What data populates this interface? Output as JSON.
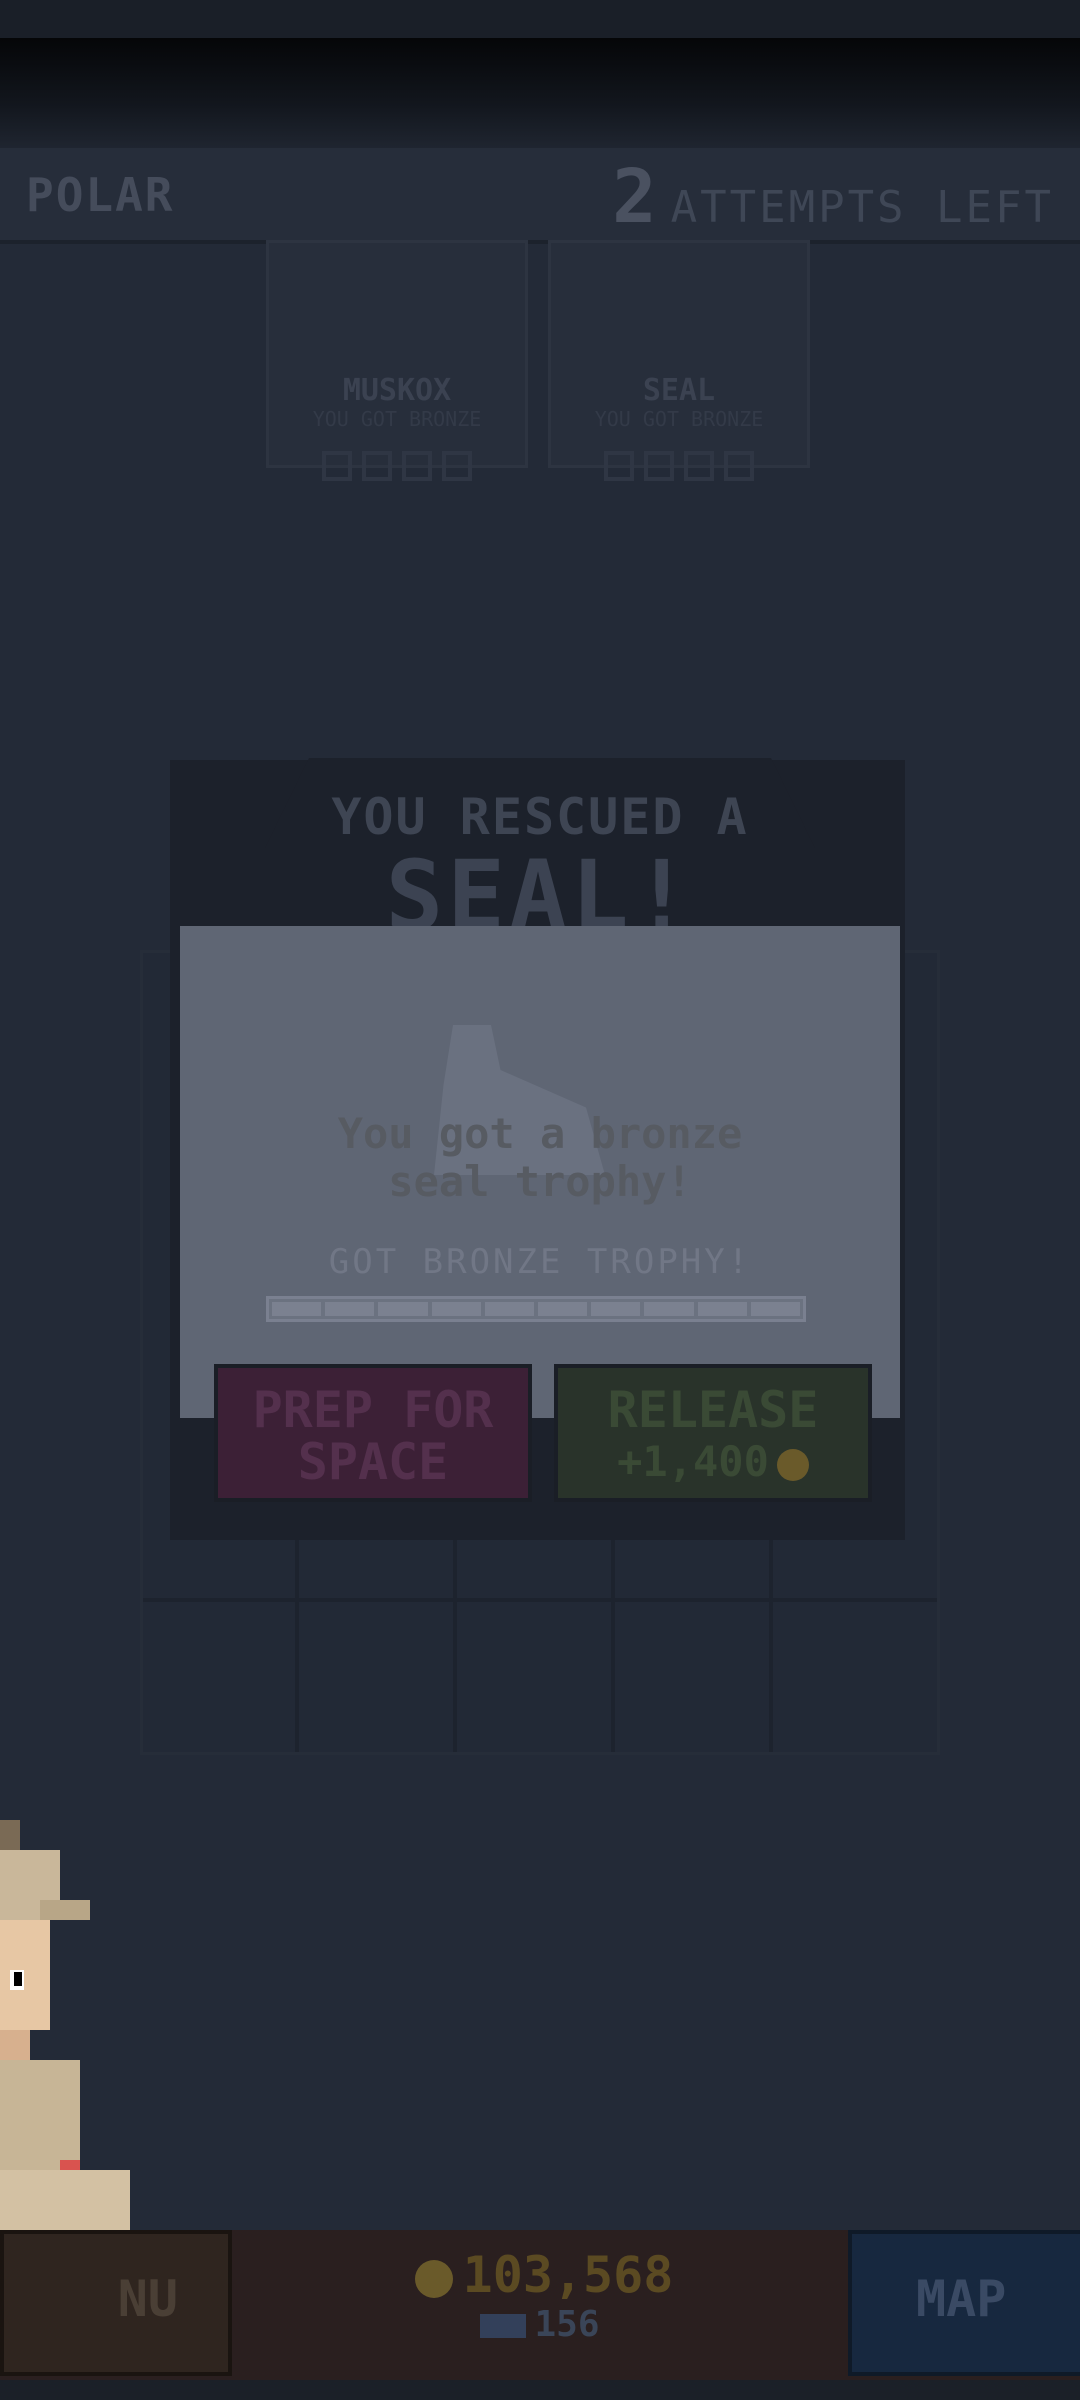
{
  "header": {
    "region": "POLAR",
    "attempts_count": "2",
    "attempts_label": "ATTEMPTS LEFT"
  },
  "animal_cards": [
    {
      "name": "MUSKOX",
      "subtitle": "YOU GOT BRONZE",
      "trophy_slots": 4,
      "filled": 0
    },
    {
      "name": "SEAL",
      "subtitle": "YOU GOT BRONZE",
      "trophy_slots": 4,
      "filled": 0
    }
  ],
  "dialog": {
    "title_line1": "YOU RESCUED A",
    "title_line2": "SEAL!",
    "trophy_message_line1": "You got a bronze",
    "trophy_message_line2": "seal trophy!",
    "progress_label": "GOT BRONZE TROPHY!",
    "progress_segments": 10,
    "buttons": {
      "prep_line1": "PREP FOR",
      "prep_line2": "SPACE",
      "release_line1": "RELEASE",
      "release_line2": "+1,400"
    }
  },
  "bottom_bar": {
    "menu_label": "NU",
    "coins": "103,568",
    "tickets": "156",
    "map_label": "MAP"
  },
  "colors": {
    "background": "#232a37",
    "overlay": "#5f6674",
    "prep_button": "#3c2036",
    "release_button": "#29332a",
    "map_button": "#17283f"
  }
}
